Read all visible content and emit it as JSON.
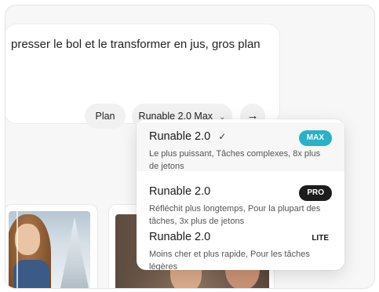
{
  "prompt": {
    "text": "presser le bol et le transformer en jus, gros plan"
  },
  "toolbar": {
    "plan_label": "Plan",
    "model_label": "Runable 2.0 Max",
    "model_chevron": "⌄",
    "send_icon": "→"
  },
  "model_menu": {
    "options": [
      {
        "name": "Runable 2.0",
        "check": "✓",
        "badge": "MAX",
        "description": "Le plus puissant, Tâches complexes, 8x plus de jetons"
      },
      {
        "name": "Runable 2.0",
        "badge": "PRO",
        "description": "Réfléchit plus longtemps, Pour la plupart des tâches, 3x plus de jetons"
      },
      {
        "name": "Runable 2.0",
        "badge": "LITE",
        "description": "Moins cher et plus rapide, Pour les tâches légères"
      }
    ]
  },
  "colors": {
    "max_badge": "#29b1c6",
    "pro_badge": "#1c1c1c"
  }
}
